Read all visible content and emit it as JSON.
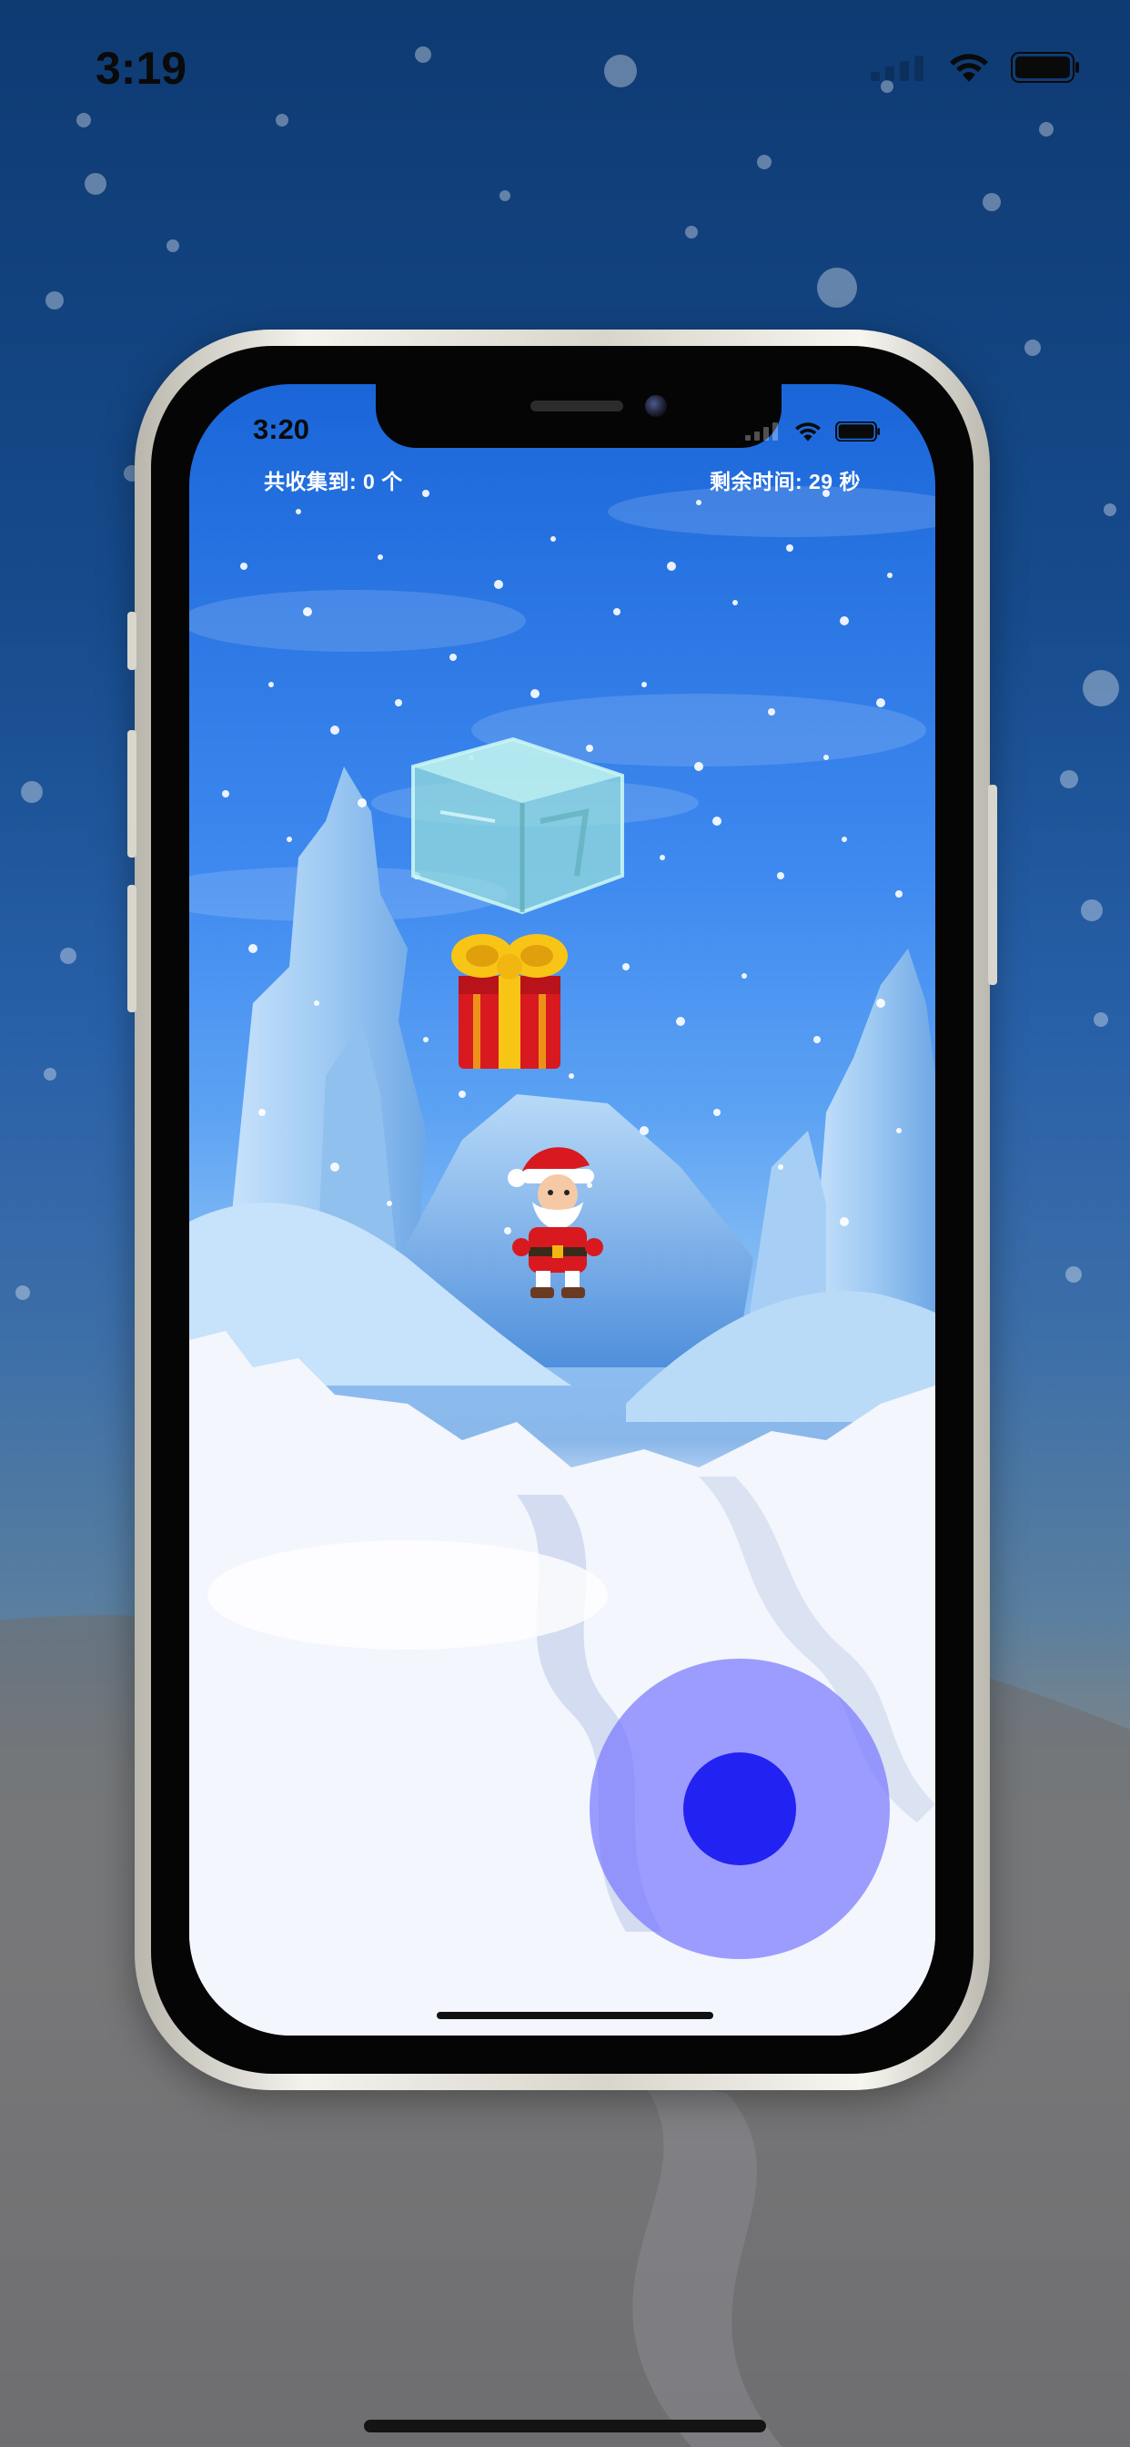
{
  "outer_status": {
    "time": "3:19"
  },
  "inner_status": {
    "time": "3:20"
  },
  "hud": {
    "collected_label": "共收集到: 0 个",
    "time_left_label": "剩余时间: 29 秒"
  },
  "joystick": {
    "knob_offset_fraction": [
      0,
      0
    ]
  },
  "icons": {
    "wifi": "wifi-icon",
    "battery": "battery-icon",
    "signal": "cellular-signal-icon",
    "gift": "gift-box",
    "ice": "ice-block",
    "santa": "santa-claus"
  },
  "colors": {
    "sky_top": "#1a66d9",
    "joystick_ring": "#7878ff",
    "joystick_knob": "#2222f2",
    "hud_text": "#ffffff"
  }
}
